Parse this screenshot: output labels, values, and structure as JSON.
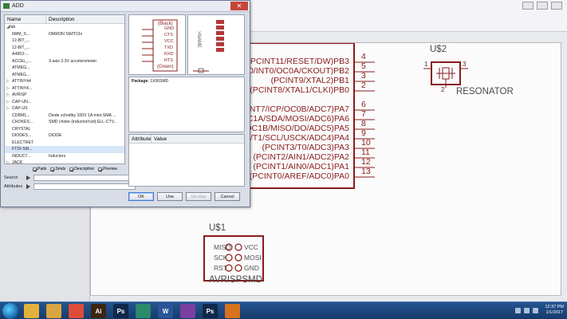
{
  "dialog": {
    "title": "ADD",
    "close_label": "✕",
    "list_headers": {
      "name": "Name",
      "description": "Description"
    },
    "library_items": [
      {
        "name": "fab",
        "description": "",
        "expander": "◢",
        "root": true
      },
      {
        "name": "6MM_S...",
        "description": "OMRON SWITCH",
        "expander": ""
      },
      {
        "name": "12-BIT_...",
        "description": "",
        "expander": ""
      },
      {
        "name": "12-BIT_...",
        "description": "",
        "expander": ""
      },
      {
        "name": "A4953-...",
        "description": "",
        "expander": ""
      },
      {
        "name": "ACCEL_...",
        "description": "3-axis 3.3V accelerometer",
        "expander": ""
      },
      {
        "name": "ATMEG...",
        "description": "",
        "expander": ""
      },
      {
        "name": "ATMEG...",
        "description": "",
        "expander": ""
      },
      {
        "name": "ATTINY44",
        "description": "",
        "expander": "▷"
      },
      {
        "name": "ATTINY4...",
        "description": "",
        "expander": "▷"
      },
      {
        "name": "AVRISP",
        "description": "",
        "expander": "▷"
      },
      {
        "name": "CAP-UN...",
        "description": "",
        "expander": "▷"
      },
      {
        "name": "CAP-US",
        "description": "",
        "expander": "▷"
      },
      {
        "name": "CDBM1...",
        "description": "Diode schottky 100V 1A mini-SMA ...",
        "expander": ""
      },
      {
        "name": "CHOKES...",
        "description": "SMD choke (inductor/coil) ELL-CTV...",
        "expander": ""
      },
      {
        "name": "CRYSTAL",
        "description": "",
        "expander": ""
      },
      {
        "name": "DIODES...",
        "description": "DIODE",
        "expander": ""
      },
      {
        "name": "ELECTRET",
        "description": "",
        "expander": ""
      },
      {
        "name": "FTDI-SM...",
        "description": "",
        "expander": "",
        "selected": true
      },
      {
        "name": "INDUCT...",
        "description": "Inductors",
        "expander": ""
      },
      {
        "name": "JACK",
        "description": "",
        "expander": "▷"
      }
    ],
    "filters": [
      {
        "label": "Pads",
        "checked": true
      },
      {
        "label": "Smds",
        "checked": true
      },
      {
        "label": "Description",
        "checked": true
      },
      {
        "label": "Preview",
        "checked": true
      }
    ],
    "search_label": "Search",
    "search_value": "",
    "attributes_label": "Attributes",
    "attributes_value": "",
    "symbol_preview": {
      "top_label": "(Black)",
      "pins": [
        "GND",
        "CTS",
        "VCC",
        "TXD",
        "RXD",
        "RTS"
      ],
      "bottom_label": "(Green)"
    },
    "package_preview": {
      "name_label": ">NAME"
    },
    "package_label": "Package:",
    "package_value": "1X06SMD",
    "attr_headers": {
      "attribute": "Attribute",
      "value": "Value"
    },
    "buttons": {
      "ok": "OK",
      "use": "Use",
      "unuse": "Un-Use",
      "cancel": "Cancel"
    }
  },
  "schematic": {
    "microcontroller_pins": [
      {
        "label": "(PCINT11/RESET/DW)PB3",
        "num": "4"
      },
      {
        "label": "T10/INT0/OC0A/CKOUT)PB2",
        "num": "5"
      },
      {
        "label": "(PCINT9/XTAL2)PB1",
        "num": "3"
      },
      {
        "label": "(PCINT8/XTAL1/CLKI)PB0",
        "num": "2"
      },
      {
        "label": "(PCINT7/ICP/OC0B/ADC7)PA7",
        "num": "6"
      },
      {
        "label": "OC1A/SDA/MOSI/ADC6)PA6",
        "num": "7"
      },
      {
        "label": "/OC1B/MISO/DO/ADC5)PA5",
        "num": "8"
      },
      {
        "label": "T4/T1/SCL/USCK/ADC4)PA4",
        "num": "9"
      },
      {
        "label": "(PCINT3/T0/ADC3)PA3",
        "num": "10"
      },
      {
        "label": "(PCINT2/AIN1/ADC2)PA2",
        "num": "11"
      },
      {
        "label": "(PCINT1/AIN0/ADC1)PA1",
        "num": "12"
      },
      {
        "label": "(PCINT0/AREF/ADC0)PA0",
        "num": "13"
      }
    ],
    "resonator": {
      "designator": "U$2",
      "value": "RESONATOR",
      "pins": [
        "1",
        "3",
        "2"
      ]
    },
    "avrisp": {
      "designator": "U$1",
      "value": "AVRISPSMD",
      "left_pins": [
        "MISO",
        "SCK",
        "RST"
      ],
      "right_pins": [
        "VCC",
        "MOSI",
        "GND"
      ]
    }
  },
  "taskbar": {
    "apps": [
      {
        "name": "file-explorer",
        "letter": "",
        "color": "#e3b23c"
      },
      {
        "name": "folder",
        "letter": "",
        "color": "#d9a441"
      },
      {
        "name": "chrome",
        "letter": "",
        "color": "#dd4b39"
      },
      {
        "name": "illustrator",
        "letter": "Ai",
        "color": "#3b2513"
      },
      {
        "name": "photoshop",
        "letter": "Ps",
        "color": "#10284a"
      },
      {
        "name": "app-green",
        "letter": "",
        "color": "#2b8a6a"
      },
      {
        "name": "word",
        "letter": "W",
        "color": "#2a5699"
      },
      {
        "name": "app-rainbow",
        "letter": "",
        "color": "#7a3fa0"
      },
      {
        "name": "photoshop-2",
        "letter": "Ps",
        "color": "#10284a"
      },
      {
        "name": "eagle",
        "letter": "",
        "color": "#d8721c"
      }
    ],
    "clock_time": "12:37 PM",
    "clock_date": "1/1/2017"
  }
}
